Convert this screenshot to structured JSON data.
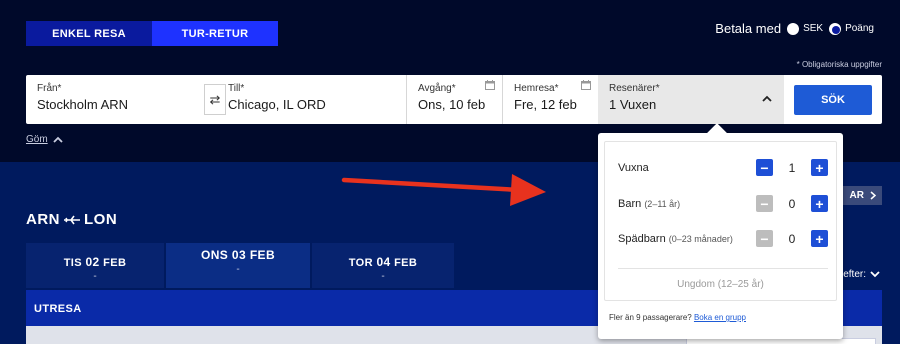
{
  "trip_type": {
    "one_way": "ENKEL RESA",
    "round_trip": "TUR-RETUR"
  },
  "pay_with": {
    "label": "Betala med",
    "options": [
      "SEK",
      "Poäng"
    ],
    "selected": "Poäng"
  },
  "mandatory_note": "* Obligatoriska uppgifter",
  "search": {
    "from_label": "Från*",
    "from_value": "Stockholm ARN",
    "to_label": "Till*",
    "to_value": "Chicago, IL ORD",
    "departure_label": "Avgång*",
    "departure_value": "Ons, 10 feb",
    "return_label": "Hemresa*",
    "return_value": "Fre, 12 feb",
    "travelers_label": "Resenärer*",
    "travelers_value": "1 Vuxen",
    "search_button": "SÖK"
  },
  "hide_link": "Göm",
  "route": {
    "from": "ARN",
    "to": "LON"
  },
  "day_tabs": [
    {
      "day": "TIS",
      "date": "02",
      "month": "FEB",
      "price": "-"
    },
    {
      "day": "ONS",
      "date": "03",
      "month": "FEB",
      "price": "-"
    },
    {
      "day": "TOR",
      "date": "04",
      "month": "FEB",
      "price": "-"
    }
  ],
  "utresa_label": "UTRESA",
  "sort_label": "efter:",
  "partial_button": "AR",
  "passengers": {
    "adults": {
      "label": "Vuxna",
      "age": "",
      "count": "1"
    },
    "children": {
      "label": "Barn",
      "age": "(2–11 år)",
      "count": "0"
    },
    "infants": {
      "label": "Spädbarn",
      "age": "(0–23 månader)",
      "count": "0"
    },
    "youth": "Ungdom (12–25 år)",
    "footer_text": "Fler än 9 passagerare?",
    "footer_link": "Boka en grupp"
  },
  "colors": {
    "background": "#00092a",
    "accent": "#1e32ff",
    "button": "#1e5bd6",
    "arrow": "#e8321e"
  }
}
